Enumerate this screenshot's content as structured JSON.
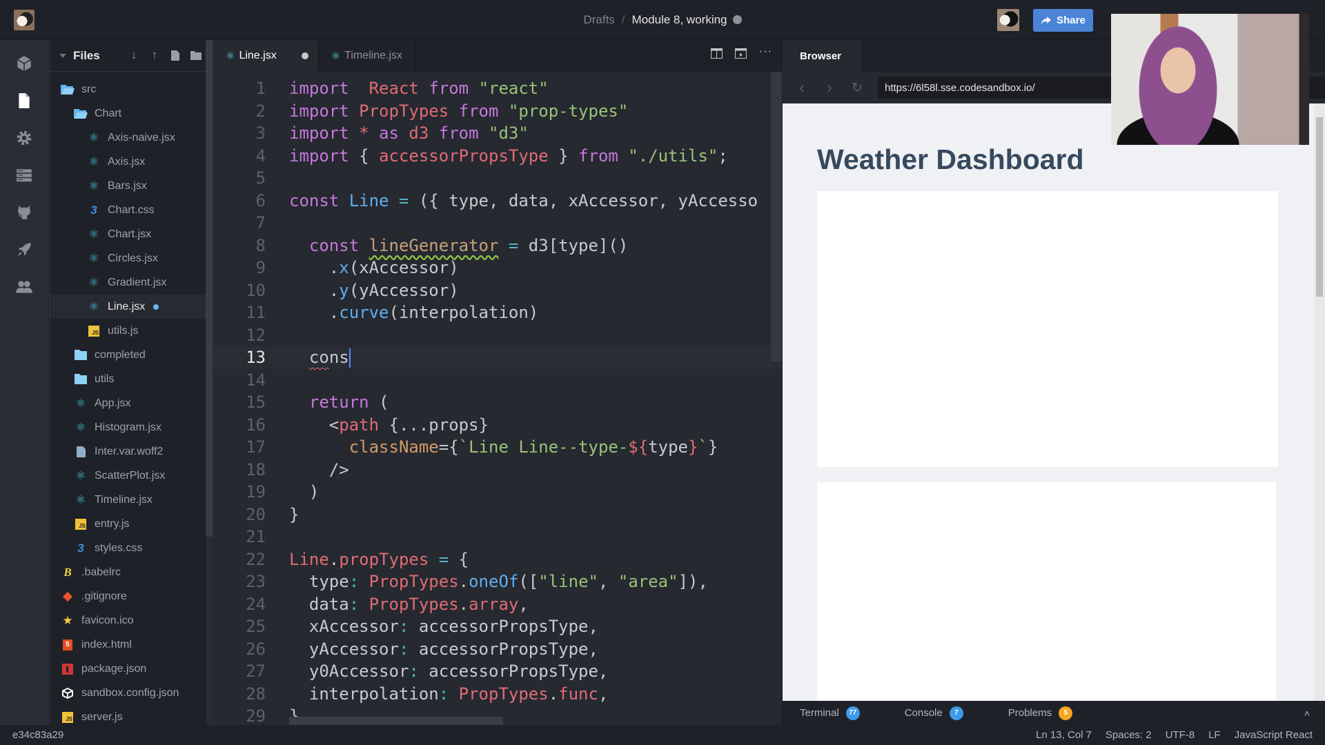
{
  "topbar": {
    "breadcrumb_parent": "Drafts",
    "breadcrumb_separator": "/",
    "project_title": "Module 8, working",
    "share_label": "Share",
    "share_color": "#4b83d6"
  },
  "activity_bar": {
    "items": [
      {
        "icon": "cube-icon",
        "label": "Project Info"
      },
      {
        "icon": "file-icon",
        "label": "Explorer",
        "active": true
      },
      {
        "icon": "gear-icon",
        "label": "Config"
      },
      {
        "icon": "server-icon",
        "label": "Server Control"
      },
      {
        "icon": "github-icon",
        "label": "GitHub"
      },
      {
        "icon": "rocket-icon",
        "label": "Deployment"
      },
      {
        "icon": "users-icon",
        "label": "Live"
      }
    ]
  },
  "files": {
    "title": "Files",
    "tree": [
      {
        "name": "src",
        "type": "folder-open",
        "depth": 0
      },
      {
        "name": "Chart",
        "type": "folder-open",
        "depth": 1
      },
      {
        "name": "Axis-naive.jsx",
        "type": "react",
        "depth": 2
      },
      {
        "name": "Axis.jsx",
        "type": "react",
        "depth": 2
      },
      {
        "name": "Bars.jsx",
        "type": "react",
        "depth": 2
      },
      {
        "name": "Chart.css",
        "type": "css",
        "depth": 2
      },
      {
        "name": "Chart.jsx",
        "type": "react",
        "depth": 2
      },
      {
        "name": "Circles.jsx",
        "type": "react",
        "depth": 2
      },
      {
        "name": "Gradient.jsx",
        "type": "react",
        "depth": 2
      },
      {
        "name": "Line.jsx",
        "type": "react",
        "depth": 2,
        "active": true,
        "modified": true
      },
      {
        "name": "utils.js",
        "type": "js",
        "depth": 2
      },
      {
        "name": "completed",
        "type": "folder",
        "depth": 1
      },
      {
        "name": "utils",
        "type": "folder",
        "depth": 1
      },
      {
        "name": "App.jsx",
        "type": "react",
        "depth": 1
      },
      {
        "name": "Histogram.jsx",
        "type": "react",
        "depth": 1
      },
      {
        "name": "Inter.var.woff2",
        "type": "file",
        "depth": 1
      },
      {
        "name": "ScatterPlot.jsx",
        "type": "react",
        "depth": 1
      },
      {
        "name": "Timeline.jsx",
        "type": "react",
        "depth": 1
      },
      {
        "name": "entry.js",
        "type": "js",
        "depth": 1
      },
      {
        "name": "styles.css",
        "type": "css",
        "depth": 1
      },
      {
        "name": ".babelrc",
        "type": "babel",
        "depth": 0
      },
      {
        "name": ".gitignore",
        "type": "git",
        "depth": 0
      },
      {
        "name": "favicon.ico",
        "type": "star",
        "depth": 0
      },
      {
        "name": "index.html",
        "type": "html",
        "depth": 0
      },
      {
        "name": "package.json",
        "type": "npm",
        "depth": 0
      },
      {
        "name": "sandbox.config.json",
        "type": "sandbox",
        "depth": 0
      },
      {
        "name": "server.js",
        "type": "js",
        "depth": 0
      }
    ]
  },
  "editor": {
    "tabs": [
      {
        "label": "Line.jsx",
        "active": true,
        "modified": true
      },
      {
        "label": "Timeline.jsx",
        "active": false
      }
    ],
    "current_line": 13,
    "lines": [
      [
        [
          "kw",
          "import"
        ],
        [
          "",
          "  "
        ],
        [
          "red",
          "React"
        ],
        [
          "",
          " "
        ],
        [
          "kw",
          "from"
        ],
        [
          "",
          " "
        ],
        [
          "str",
          "\"react\""
        ]
      ],
      [
        [
          "kw",
          "import"
        ],
        [
          "",
          " "
        ],
        [
          "red",
          "PropTypes"
        ],
        [
          "",
          " "
        ],
        [
          "kw",
          "from"
        ],
        [
          "",
          " "
        ],
        [
          "str",
          "\"prop-types\""
        ]
      ],
      [
        [
          "kw",
          "import"
        ],
        [
          "",
          " "
        ],
        [
          "red",
          "*"
        ],
        [
          "",
          " "
        ],
        [
          "kw",
          "as"
        ],
        [
          "",
          " "
        ],
        [
          "red",
          "d3"
        ],
        [
          "",
          " "
        ],
        [
          "kw",
          "from"
        ],
        [
          "",
          " "
        ],
        [
          "str",
          "\"d3\""
        ]
      ],
      [
        [
          "kw",
          "import"
        ],
        [
          "",
          " { "
        ],
        [
          "red",
          "accessorPropsType"
        ],
        [
          "",
          " } "
        ],
        [
          "kw",
          "from"
        ],
        [
          "",
          " "
        ],
        [
          "str",
          "\"./utils\""
        ],
        [
          "",
          ";"
        ]
      ],
      [],
      [
        [
          "kw",
          "const"
        ],
        [
          "",
          " "
        ],
        [
          "fn",
          "Line"
        ],
        [
          "",
          " "
        ],
        [
          "cy",
          "="
        ],
        [
          "",
          " ({ type, data, xAccessor, yAccesso"
        ]
      ],
      [],
      [
        [
          "",
          "  "
        ],
        [
          "kw",
          "const"
        ],
        [
          "",
          " "
        ],
        [
          "brown squig",
          "lineGenerator"
        ],
        [
          "",
          " "
        ],
        [
          "cy",
          "="
        ],
        [
          "",
          " d3[type]()"
        ]
      ],
      [
        [
          "",
          "    ."
        ],
        [
          "fn",
          "x"
        ],
        [
          "",
          "(xAccessor)"
        ]
      ],
      [
        [
          "",
          "    ."
        ],
        [
          "fn",
          "y"
        ],
        [
          "",
          "(yAccessor)"
        ]
      ],
      [
        [
          "",
          "    ."
        ],
        [
          "fn",
          "curve"
        ],
        [
          "",
          "(interpolation)"
        ]
      ],
      [],
      [
        [
          "",
          "  "
        ],
        [
          "squig-red",
          "co"
        ],
        [
          "",
          "ns"
        ],
        [
          "cursor",
          ""
        ]
      ],
      [],
      [
        [
          "",
          "  "
        ],
        [
          "kw",
          "return"
        ],
        [
          "",
          " ("
        ]
      ],
      [
        [
          "",
          "    <"
        ],
        [
          "red",
          "path"
        ],
        [
          "",
          " {...props}"
        ]
      ],
      [
        [
          "",
          "      "
        ],
        [
          "orange",
          "className"
        ],
        [
          "",
          "={"
        ],
        [
          "str",
          "`Line Line--type-"
        ],
        [
          "red",
          "${"
        ],
        [
          "",
          "type"
        ],
        [
          "red",
          "}"
        ],
        [
          "str",
          "`"
        ],
        [
          "",
          "}"
        ]
      ],
      [
        [
          "",
          "    />"
        ]
      ],
      [
        [
          "",
          "  )"
        ]
      ],
      [
        [
          "",
          "}"
        ]
      ],
      [],
      [
        [
          "red",
          "Line"
        ],
        [
          "",
          "."
        ],
        [
          "red",
          "propTypes"
        ],
        [
          "",
          " "
        ],
        [
          "cy",
          "="
        ],
        [
          "",
          " {"
        ]
      ],
      [
        [
          "",
          "  type"
        ],
        [
          "cy",
          ":"
        ],
        [
          "",
          " "
        ],
        [
          "red",
          "PropTypes"
        ],
        [
          "",
          "."
        ],
        [
          "fn",
          "oneOf"
        ],
        [
          "",
          "(["
        ],
        [
          "str",
          "\"line\""
        ],
        [
          "",
          ", "
        ],
        [
          "str",
          "\"area\""
        ],
        [
          "",
          "]),"
        ]
      ],
      [
        [
          "",
          "  data"
        ],
        [
          "cy",
          ":"
        ],
        [
          "",
          " "
        ],
        [
          "red",
          "PropTypes"
        ],
        [
          "",
          "."
        ],
        [
          "red",
          "array"
        ],
        [
          "",
          ","
        ]
      ],
      [
        [
          "",
          "  xAccessor"
        ],
        [
          "cy",
          ":"
        ],
        [
          "",
          " accessorPropsType,"
        ]
      ],
      [
        [
          "",
          "  yAccessor"
        ],
        [
          "cy",
          ":"
        ],
        [
          "",
          " accessorPropsType,"
        ]
      ],
      [
        [
          "",
          "  y0Accessor"
        ],
        [
          "cy",
          ":"
        ],
        [
          "",
          " accessorPropsType,"
        ]
      ],
      [
        [
          "",
          "  interpolation"
        ],
        [
          "cy",
          ":"
        ],
        [
          "",
          " "
        ],
        [
          "red",
          "PropTypes"
        ],
        [
          "",
          "."
        ],
        [
          "red",
          "func"
        ],
        [
          "",
          ","
        ]
      ],
      [
        [
          "",
          "}"
        ]
      ]
    ]
  },
  "browser": {
    "tab_label": "Browser",
    "url": "https://6l58l.sse.codesandbox.io/",
    "page_heading": "Weather Dashboard"
  },
  "bottom_panel": {
    "tabs": [
      {
        "label": "Terminal",
        "count": "77",
        "color": "#3d9be9"
      },
      {
        "label": "Console",
        "count": "7",
        "color": "#3d9be9"
      },
      {
        "label": "Problems",
        "count": "5",
        "color": "#f5a623"
      }
    ]
  },
  "statusbar": {
    "commit": "e34c83a29",
    "position": "Ln 13, Col 7",
    "spaces": "Spaces: 2",
    "encoding": "UTF-8",
    "eol": "LF",
    "language": "JavaScript React"
  }
}
